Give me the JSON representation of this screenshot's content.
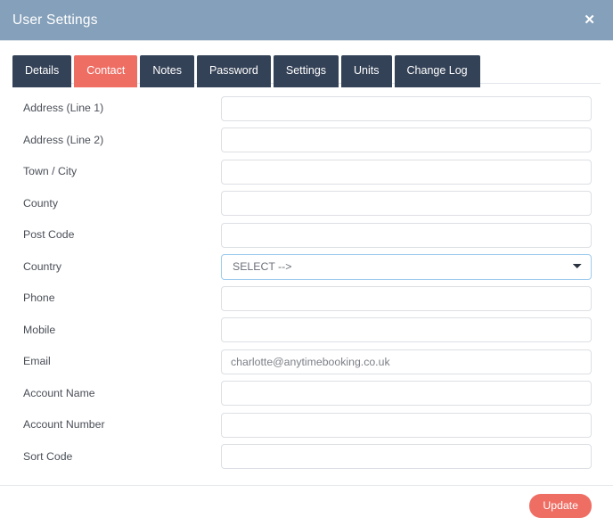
{
  "header": {
    "title": "User Settings",
    "close_label": "✕"
  },
  "tabs": [
    {
      "label": "Details",
      "active": false
    },
    {
      "label": "Contact",
      "active": true
    },
    {
      "label": "Notes",
      "active": false
    },
    {
      "label": "Password",
      "active": false
    },
    {
      "label": "Settings",
      "active": false
    },
    {
      "label": "Units",
      "active": false
    },
    {
      "label": "Change Log",
      "active": false
    }
  ],
  "form": {
    "fields": [
      {
        "name": "address-line-1",
        "label": "Address (Line 1)",
        "type": "text",
        "value": ""
      },
      {
        "name": "address-line-2",
        "label": "Address (Line 2)",
        "type": "text",
        "value": ""
      },
      {
        "name": "town-city",
        "label": "Town / City",
        "type": "text",
        "value": ""
      },
      {
        "name": "county",
        "label": "County",
        "type": "text",
        "value": ""
      },
      {
        "name": "post-code",
        "label": "Post Code",
        "type": "text",
        "value": ""
      },
      {
        "name": "country",
        "label": "Country",
        "type": "select",
        "value": "SELECT -->",
        "options": [
          "SELECT -->"
        ]
      },
      {
        "name": "phone",
        "label": "Phone",
        "type": "text",
        "value": ""
      },
      {
        "name": "mobile",
        "label": "Mobile",
        "type": "text",
        "value": ""
      },
      {
        "name": "email",
        "label": "Email",
        "type": "text",
        "value": "charlotte@anytimebooking.co.uk"
      },
      {
        "name": "account-name",
        "label": "Account Name",
        "type": "text",
        "value": ""
      },
      {
        "name": "account-number",
        "label": "Account Number",
        "type": "text",
        "value": ""
      },
      {
        "name": "sort-code",
        "label": "Sort Code",
        "type": "text",
        "value": ""
      }
    ]
  },
  "footer": {
    "update_label": "Update"
  },
  "colors": {
    "header_bg": "#85a0ba",
    "tab_bg": "#344257",
    "accent": "#ef6e64",
    "label_text": "#4a4f57",
    "input_border": "#dcdfe3",
    "select_border": "#9ecbee"
  }
}
